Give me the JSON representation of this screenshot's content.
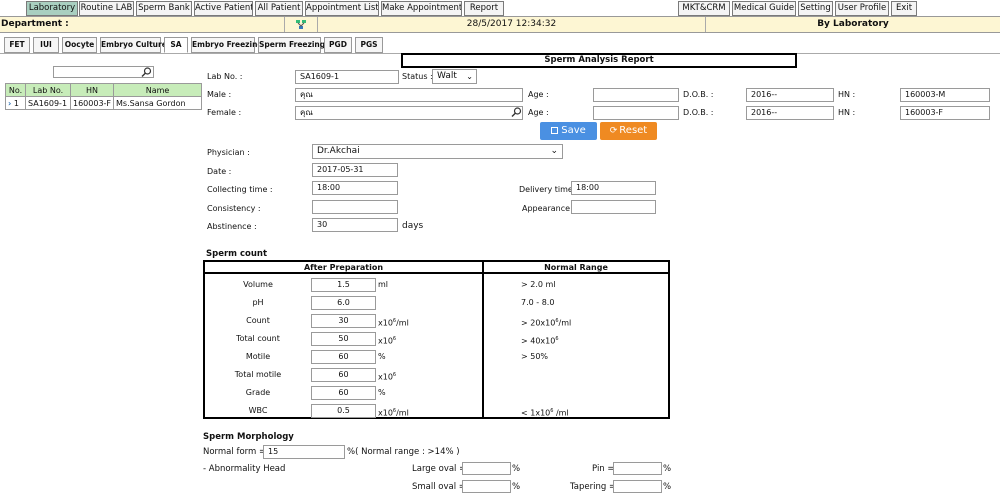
{
  "nav": {
    "items": [
      "Laboratory",
      "Routine LAB",
      "Sperm Bank",
      "Active Patient",
      "All Patient",
      "Appointment List",
      "Make Appointment",
      "Report"
    ],
    "right_items": [
      "MKT&CRM",
      "Medical Guide",
      "Setting",
      "User Profile",
      "Exit"
    ],
    "active": "Laboratory"
  },
  "infobar": {
    "department": "Department :",
    "datetime": "28/5/2017 12:34:32",
    "by": "By Laboratory"
  },
  "subtabs": [
    "FET",
    "IUI",
    "Oocyte",
    "Embryo Culture",
    "SA",
    "Embryo Freezing",
    "Sperm Freezing",
    "PGD",
    "PGS"
  ],
  "subtab_active": "SA",
  "sidebar": {
    "search_value": "",
    "columns": [
      "No.",
      "Lab No.",
      "HN",
      "Name"
    ],
    "rows": [
      {
        "no": "1",
        "lab_no": "SA1609-1",
        "hn": "160003-F",
        "name": "Ms.Sansa Gordon"
      }
    ]
  },
  "report": {
    "title": "Sperm Analysis Report",
    "lab_no_label": "Lab No. :",
    "lab_no": "SA1609-1",
    "status_label": "Status :",
    "status": "Walt",
    "male_label": "Male :",
    "male_value": "คุณ",
    "female_label": "Female :",
    "female_value": "คุณ",
    "age_label": "Age :",
    "dob_label": "D.O.B. :",
    "hn_label": "HN :",
    "male_dob": "2016--",
    "male_hn": "160003-M",
    "female_dob": "2016--",
    "female_hn": "160003-F",
    "save_label": "Save",
    "reset_label": "Reset",
    "physician_label": "Physician :",
    "physician": "Dr.Akchai",
    "date_label": "Date :",
    "date": "2017-05-31",
    "collecting_label": "Collecting time :",
    "collecting": "18:00",
    "delivery_label": "Delivery time :",
    "delivery": "18:00",
    "consistency_label": "Consistency :",
    "appearance_label": "Appearance :",
    "abstinence_label": "Abstinence :",
    "abstinence": "30",
    "abstinence_unit": "days"
  },
  "sperm_count": {
    "heading": "Sperm count",
    "col_after": "After Preparation",
    "col_normal": "Normal Range",
    "rows": [
      {
        "label": "Volume",
        "value": "1.5",
        "unit": "ml",
        "normal": "> 2.0 ml"
      },
      {
        "label": "pH",
        "value": "6.0",
        "unit": "",
        "normal": "7.0 - 8.0"
      },
      {
        "label": "Count",
        "value": "30",
        "unit": "x10",
        "unit_sup": "6",
        "unit_tail": "/ml",
        "normal": "> 20x10",
        "normal_sup": "6",
        "normal_tail": "/ml"
      },
      {
        "label": "Total count",
        "value": "50",
        "unit": "x10",
        "unit_sup": "6",
        "unit_tail": "",
        "normal": "> 40x10",
        "normal_sup": "6",
        "normal_tail": ""
      },
      {
        "label": "Motile",
        "value": "60",
        "unit": "%",
        "normal": "> 50%"
      },
      {
        "label": "Total motile",
        "value": "60",
        "unit": "x10",
        "unit_sup": "6",
        "unit_tail": "",
        "normal": ""
      },
      {
        "label": "Grade",
        "value": "60",
        "unit": "%",
        "normal": ""
      },
      {
        "label": "WBC",
        "value": "0.5",
        "unit": "x10",
        "unit_sup": "6",
        "unit_tail": "/ml",
        "normal": "< 1x10",
        "normal_sup": "6",
        "normal_tail": " /ml"
      }
    ]
  },
  "morphology": {
    "heading": "Sperm Morphology",
    "normal_form_label": "Normal form =",
    "normal_form": "15",
    "normal_form_suffix": "%( Normal range : >14% )",
    "abnormality_head": "- Abnormality Head",
    "large_oval": "Large oval =",
    "small_oval": "Small oval =",
    "pin": "Pin =",
    "tapering": "Tapering =",
    "percent": "%"
  },
  "colors": {
    "nav_active": "#a9cfc0",
    "infobar": "#fdf6d3",
    "table_header": "#c7ecb9",
    "save": "#4a90e2",
    "reset": "#ef8a22"
  }
}
